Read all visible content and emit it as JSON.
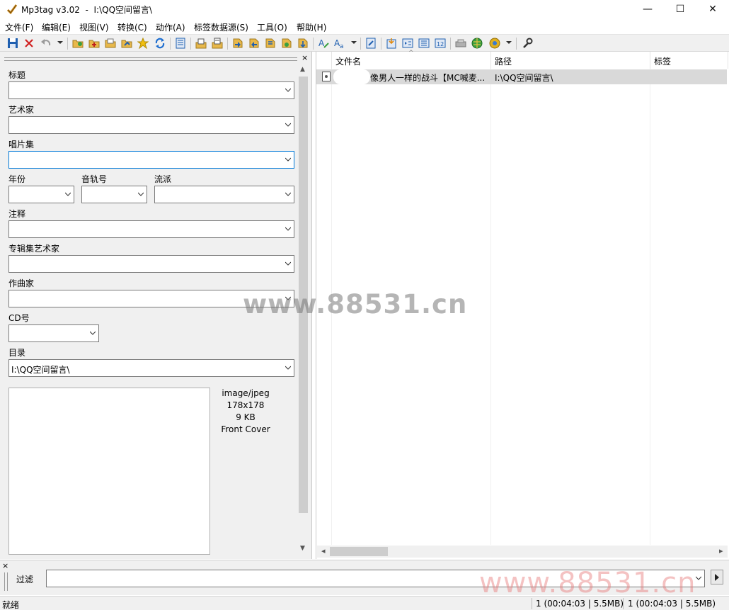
{
  "window": {
    "title": "Mp3tag v3.02  -  I:\\QQ空间留言\\",
    "minimize": "—",
    "maximize": "☐",
    "close": "✕"
  },
  "menu": [
    "文件(F)",
    "编辑(E)",
    "视图(V)",
    "转换(C)",
    "动作(A)",
    "标签数据源(S)",
    "工具(O)",
    "帮助(H)"
  ],
  "tag_panel": {
    "title_label": "标题",
    "artist_label": "艺术家",
    "album_label": "唱片集",
    "year_label": "年份",
    "track_label": "音轨号",
    "genre_label": "流派",
    "comment_label": "注释",
    "album_artist_label": "专辑集艺术家",
    "composer_label": "作曲家",
    "disc_label": "CD号",
    "directory_label": "目录",
    "directory_value": "I:\\QQ空间留言\\",
    "close_glyph": "×",
    "cover": {
      "mime": "image/jpeg",
      "size": "178x178",
      "filesize": "9 KB",
      "type": "Front Cover"
    }
  },
  "file_list": {
    "columns": [
      "文件名",
      "路径",
      "标签"
    ],
    "rows": [
      {
        "filename": "像男人一样的战斗【MC喊麦...",
        "path": "I:\\QQ空间留言\\",
        "tag": ""
      }
    ]
  },
  "filter": {
    "label": "过滤",
    "value": "",
    "close_glyph": "×"
  },
  "status": {
    "ready": "就绪",
    "selected": "1 (00:04:03 | 5.5MB)",
    "total": "1 (00:04:03 | 5.5MB)"
  },
  "watermarks": [
    "www.88531.cn",
    "www.88531.cn"
  ],
  "colors": {
    "focus_border": "#0078d7",
    "selection": "#d9d9d9"
  }
}
